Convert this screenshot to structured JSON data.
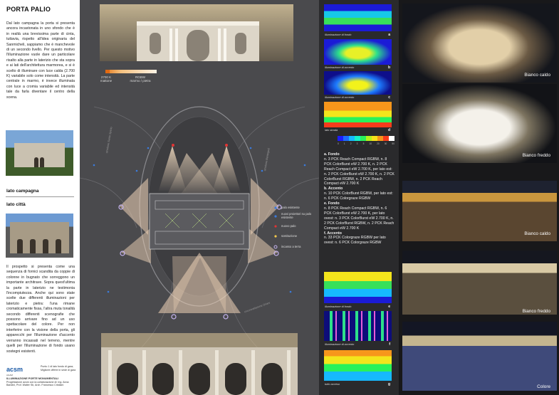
{
  "left": {
    "title": "PORTA PALIO",
    "intro": "Dal lato campagna la porta si presenta ancora incastonata in uno sfondo che è in realtà una brevissima parte di cinta, tuttavia, rispetto all'idea originaria del Sanmicheli, sappiamo che è manchevole di un secondo livello. Per questo motivo l'illuminazione vuole dare un particolare risalto alla parte in laterizio che sta sopra e ai lati dell'architettura marmorea, e si è scelto di illuminare con luce calda (2.700 K) variabile solo come intensità. La parte centrale in marmo, è invece illuminata con luce a cromia variabile ed intensità tale da farla diventare il centro della scena.",
    "lato_campagna": "lato campagna",
    "lato_citta": "lato città",
    "body": "Il prospetto si presenta come una sequenza di fornici scandita da coppie di colonne in bugnato che sorreggono un importante architrave. Sopra quest'ultima la parte in laterizio ne testimonia l'incompiutezza. Anche qui sono state scelte due differenti illuminazioni per laterizio e pietra: l'una rimane cromaticamente fissa, l'altra muta tonalità secondo differenti scenografie che possono arrivare fino ad un uso spettacolare del colore. Per non interferire con la visione della porta, gli apparecchi per l'illuminazione d'accento verranno incassati nel terreno, mentre quelli per l'illuminazione di fondo usano sostegni esistenti.",
    "logo": "acsm",
    "logo_sub": "AGAM",
    "note": "Punto 1 di lato fondo di gara; Migliorie offerte in sede di gara",
    "credits_title": "ILLUMINAZIONE PORTE MONUMENTALI",
    "credits": "Progettazione acsm con la collaborazione di: Ing. Anna Bandini, Prof. Walter Sb, Arch. Francesco Cristiani"
  },
  "plan": {
    "swatch_2700": "2700 K\nmattone",
    "swatch_rgbw": "RGBW\nmarmo / pietra",
    "legend": [
      "palo esistente",
      "nuovi proiettori su palo esistente",
      "nuovo palo",
      "sostituzione",
      "incasso a terra"
    ],
    "street_left": "stradone Santo Spirito",
    "street_right": "stradone Bentegodi",
    "street_bottom": "circonvallazione Oriani"
  },
  "renders": {
    "captions": [
      {
        "text": "illuminazione di fondo",
        "letter": "a"
      },
      {
        "text": "illuminazione di accento",
        "letter": "b"
      },
      {
        "text": "illuminazione di accento",
        "letter": "c"
      },
      {
        "text": "lato strada",
        "letter": "d"
      },
      {
        "text": "illuminazione di fondo",
        "letter": "e"
      },
      {
        "text": "illuminazione di accento",
        "letter": "f"
      },
      {
        "text": "tutto acceso",
        "letter": "g"
      }
    ],
    "scale_labels": [
      "0",
      "1",
      "2",
      "3",
      "5",
      "10",
      "20",
      "30",
      "50"
    ],
    "scale_colors": [
      "#1d1dff",
      "#1d6bff",
      "#16b9ff",
      "#17f0c9",
      "#29f25b",
      "#b5f01c",
      "#f7e21b",
      "#f7961b",
      "#f73c1b",
      "#ffffff"
    ],
    "spec": [
      {
        "h": "a. Fondo",
        "t": "n. 3 PCK Reach Compact RGBW, n. 8 PCK ColorBurst eW 2.700 K, n. 2 PCK Reach Compact eW 2.700 K, per lato est: n. 2 PCK ColorBurst eW 2.700 K, n. 2 PCK ColorBurst RGBW, n. 2 PCK Reach Compact eW 2.700 K"
      },
      {
        "h": "b. Accento",
        "t": "n. 10 PCK ColorBurst RGBW, per lato est: n. 6 PCK Colorgraze RGBW"
      },
      {
        "h": "e. Fondo",
        "t": "n. 8 PCK Reach Compact RGBW, n. 6 PCK ColorBurst eW 2.700 K, per lato ovest: n. 3 PCK ColorBurst eW 2.700 K, n. 2 PCK ColorBurst RGBW, n. 2 PCK Reach Compact eW 2.700 K"
      },
      {
        "h": "f. Accento",
        "t": "n. 33 PCK Colorgraze RGBW per lato ovest: n. 6 PCK Colorgraze RGBW"
      }
    ]
  },
  "photos": {
    "captions": [
      "Bianco caldo",
      "Bianco freddo",
      "Bianco caldo",
      "Bianco freddo",
      "Colore"
    ]
  }
}
